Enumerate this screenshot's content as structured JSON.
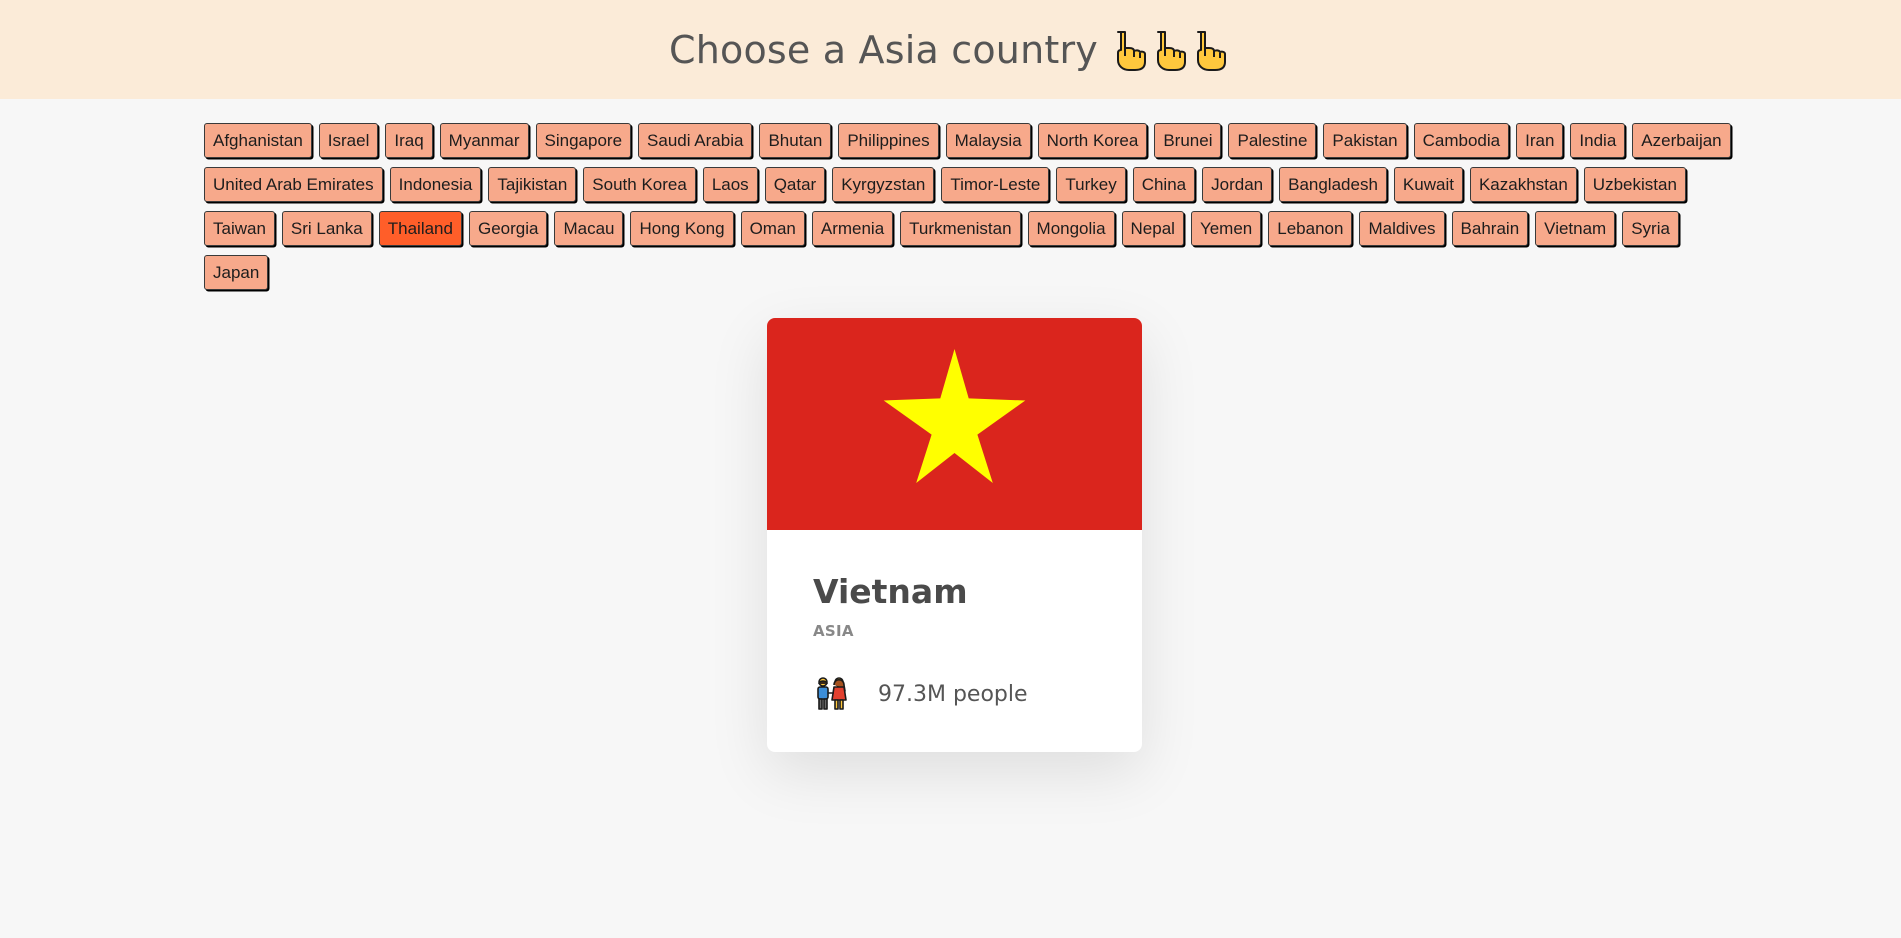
{
  "header": {
    "title": "Choose a Asia country",
    "icons": [
      "pointing-hand-icon",
      "pointing-hand-icon",
      "pointing-hand-icon"
    ]
  },
  "countries": {
    "row1": [
      "Afghanistan",
      "Israel",
      "Iraq",
      "Myanmar",
      "Singapore",
      "Saudi Arabia",
      "Bhutan",
      "Philippines",
      "Malaysia",
      "North Korea",
      "Brunei",
      "Palestine",
      "Pakistan",
      "Cambodia",
      "Iran",
      "India",
      "Azerbaijan"
    ],
    "row2": [
      "United Arab Emirates",
      "Indonesia",
      "Tajikistan",
      "South Korea",
      "Laos",
      "Qatar",
      "Kyrgyzstan",
      "Timor-Leste",
      "Turkey",
      "China",
      "Jordan",
      "Bangladesh",
      "Kuwait",
      "Kazakhstan",
      "Uzbekistan"
    ],
    "row3": [
      "Taiwan",
      "Sri Lanka",
      "Thailand",
      "Georgia",
      "Macau",
      "Hong Kong",
      "Oman",
      "Armenia",
      "Turkmenistan",
      "Mongolia",
      "Nepal",
      "Yemen",
      "Lebanon",
      "Maldives",
      "Bahrain",
      "Vietnam",
      "Syria"
    ],
    "row4": [
      "Japan"
    ],
    "active": "Thailand"
  },
  "card": {
    "name": "Vietnam",
    "region": "ASIA",
    "population": "97.3M people",
    "flag": {
      "icon": "vietnam-flag",
      "background": "#da251d",
      "star": "#ffff00"
    },
    "people_icon": "people-holding-hands-icon"
  },
  "colors": {
    "header_bg": "#fbebd8",
    "button_bg": "#f7a98b",
    "button_active_bg": "#ff5e29",
    "page_bg": "#f7f7f7"
  }
}
